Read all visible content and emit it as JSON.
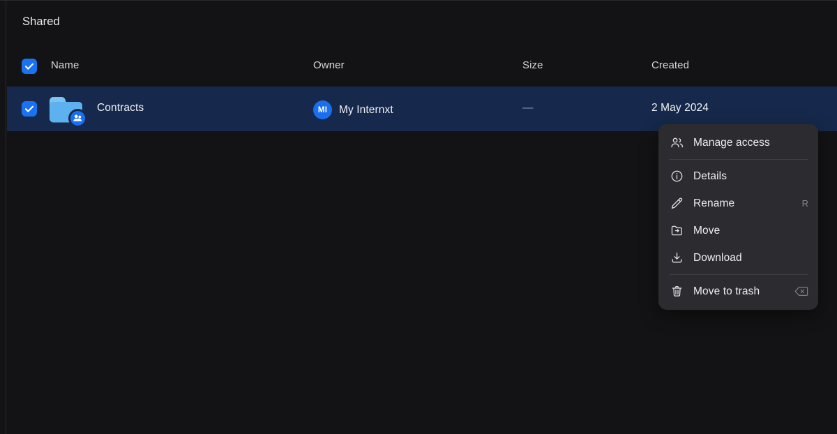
{
  "page": {
    "title": "Shared"
  },
  "table": {
    "select_all_checkbox": "checked",
    "columns": {
      "name": "Name",
      "owner": "Owner",
      "size": "Size",
      "created": "Created"
    },
    "rows": [
      {
        "selected": true,
        "icon": "shared-folder-icon",
        "name": "Contracts",
        "owner": {
          "initials": "MI",
          "name": "My Internxt",
          "avatar_color": "#1a6fee"
        },
        "size": "—",
        "created": "2 May 2024"
      }
    ]
  },
  "context_menu": {
    "groups": [
      {
        "items": [
          {
            "icon": "users-icon",
            "label": "Manage access",
            "shortcut": ""
          }
        ]
      },
      {
        "items": [
          {
            "icon": "info-circle-icon",
            "label": "Details",
            "shortcut": ""
          },
          {
            "icon": "pencil-icon",
            "label": "Rename",
            "shortcut": "R"
          },
          {
            "icon": "folder-arrow-icon",
            "label": "Move",
            "shortcut": ""
          },
          {
            "icon": "download-icon",
            "label": "Download",
            "shortcut": ""
          }
        ]
      },
      {
        "items": [
          {
            "icon": "trash-icon",
            "label": "Move to trash",
            "shortcut": "⌫"
          }
        ]
      }
    ]
  },
  "colors": {
    "background": "#131315",
    "row_selected": "#16294c",
    "accent_blue": "#1b72f0",
    "menu_background": "#2c2c30",
    "text_primary": "#eef0f3",
    "text_muted": "#8e97ab"
  }
}
